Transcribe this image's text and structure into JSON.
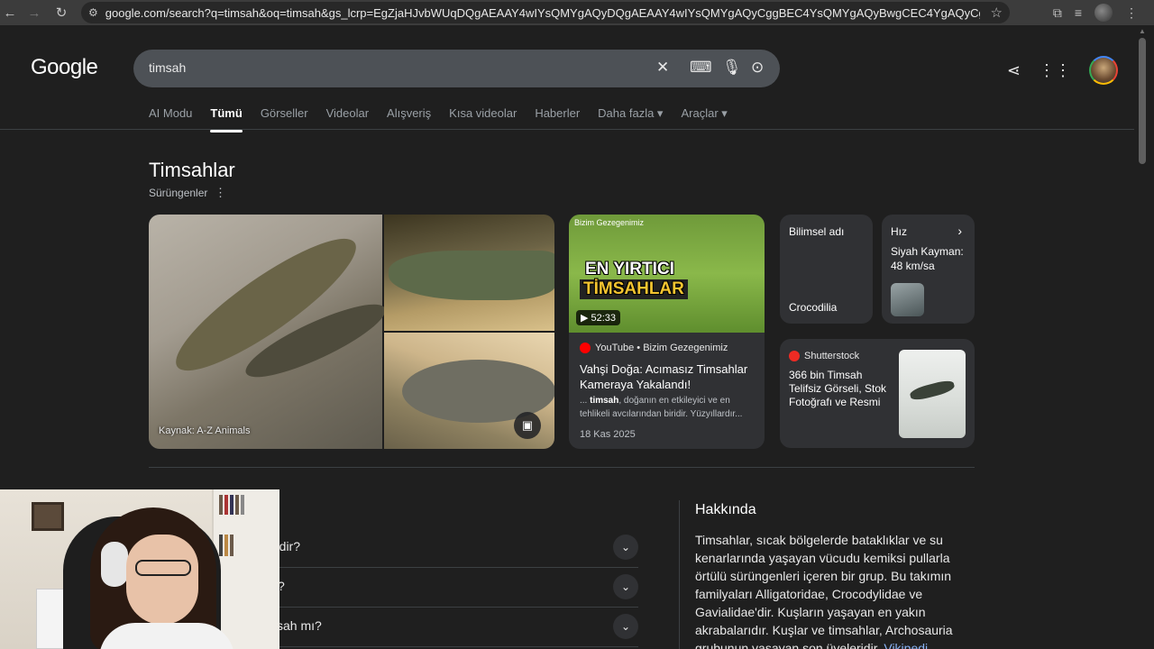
{
  "browser": {
    "url": "google.com/search?q=timsah&oq=timsah&gs_lcrp=EgZjaHJvbWUqDQgAEAAY4wIYsQMYgAQyDQgAEAAY4wIYsQMYgAQyCggBEC4YsQMYgAQyBwgCEC4YgAQyCggDEAAYsQMYgAQyFg..."
  },
  "header": {
    "logo": "Google",
    "query": "timsah"
  },
  "tabs": [
    {
      "label": "AI Modu"
    },
    {
      "label": "Tümü"
    },
    {
      "label": "Görseller"
    },
    {
      "label": "Videolar"
    },
    {
      "label": "Alışveriş"
    },
    {
      "label": "Kısa videolar"
    },
    {
      "label": "Haberler"
    },
    {
      "label": "Daha fazla ▾"
    },
    {
      "label": "Araçlar ▾"
    }
  ],
  "entity": {
    "title": "Timsahlar",
    "subtitle": "Sürüngenler",
    "image_caption": "Kaynak: A-Z Animals"
  },
  "video": {
    "thumb_brand": "Bizim Gezegenimiz",
    "thumb_line1": "EN YIRTICI",
    "thumb_line2": "TİMSAHLAR",
    "duration": "52:33",
    "source": "YouTube • Bizim Gezegenimiz",
    "title": "Vahşi Doğa: Acımasız Timsahlar Kameraya Yakalandı!",
    "snippet_pre": "... ",
    "snippet_bold": "timsah",
    "snippet_post": ", doğanın en etkileyici ve en tehlikeli avcılarından biridir. Yüzyıllardır...",
    "date": "18 Kas 2025"
  },
  "facts": {
    "sci_label": "Bilimsel adı",
    "sci_value": "Crocodilia",
    "speed_label": "Hız",
    "speed_value": "Siyah Kayman: 48 km/sa"
  },
  "stock": {
    "source": "Shutterstock",
    "title": "366 bin Timsah Telifsiz Görseli, Stok Fotoğrafı ve Resmi"
  },
  "paa": [
    {
      "question": "rdir?"
    },
    {
      "question": "?"
    },
    {
      "question": "sah mı?"
    }
  ],
  "about": {
    "title": "Hakkında",
    "text": "Timsahlar, sıcak bölgelerde bataklıklar ve su kenarlarında yaşayan vücudu kemiksi pullarla örtülü sürüngenleri içeren bir grup. Bu takımın familyaları Alligatoridae, Crocodylidae ve Gavialidae'dir. Kuşların yaşayan en yakın akrabalarıdır. Kuşlar ve timsahlar, Archosauria grubunun yaşayan son üyeleridir.",
    "link": "Vikipedi"
  }
}
